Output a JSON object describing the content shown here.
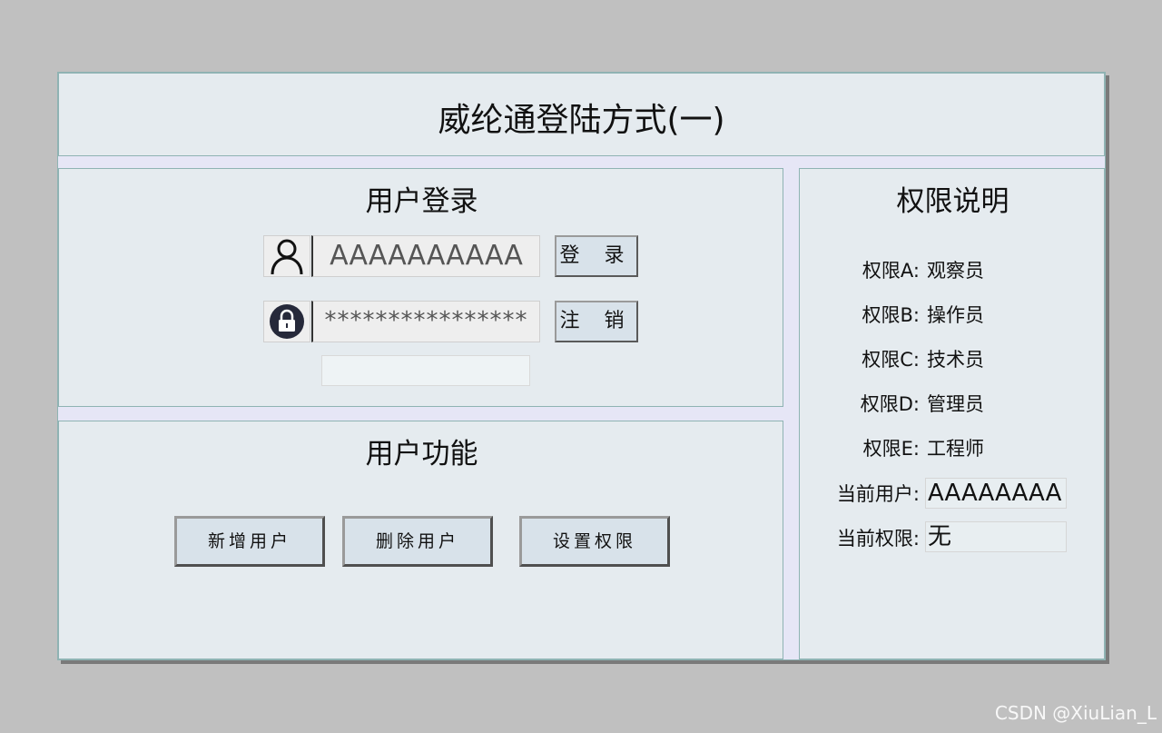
{
  "title": "威纶通登陆方式(一)",
  "login": {
    "heading": "用户登录",
    "username_value": "AAAAAAAAAA",
    "password_value": "****************",
    "login_button": "登 录",
    "logout_button": "注 销",
    "message": ""
  },
  "functions": {
    "heading": "用户功能",
    "buttons": [
      "新增用户",
      "删除用户",
      "设置权限"
    ]
  },
  "permissions": {
    "heading": "权限说明",
    "levels": [
      {
        "label": "权限A:",
        "value": "观察员"
      },
      {
        "label": "权限B:",
        "value": "操作员"
      },
      {
        "label": "权限C:",
        "value": "技术员"
      },
      {
        "label": "权限D:",
        "value": "管理员"
      },
      {
        "label": "权限E:",
        "value": "工程师"
      }
    ],
    "current_user_label": "当前用户:",
    "current_user_value": "AAAAAAAA",
    "current_perm_label": "当前权限:",
    "current_perm_value": "无"
  },
  "watermark": "CSDN @XiuLian_L",
  "icons": {
    "user": "user-icon",
    "lock": "lock-icon"
  },
  "colors": {
    "panel_bg": "#e5ebef",
    "button_bg": "#d8e2ea",
    "page_bg": "#c0c0c0"
  }
}
